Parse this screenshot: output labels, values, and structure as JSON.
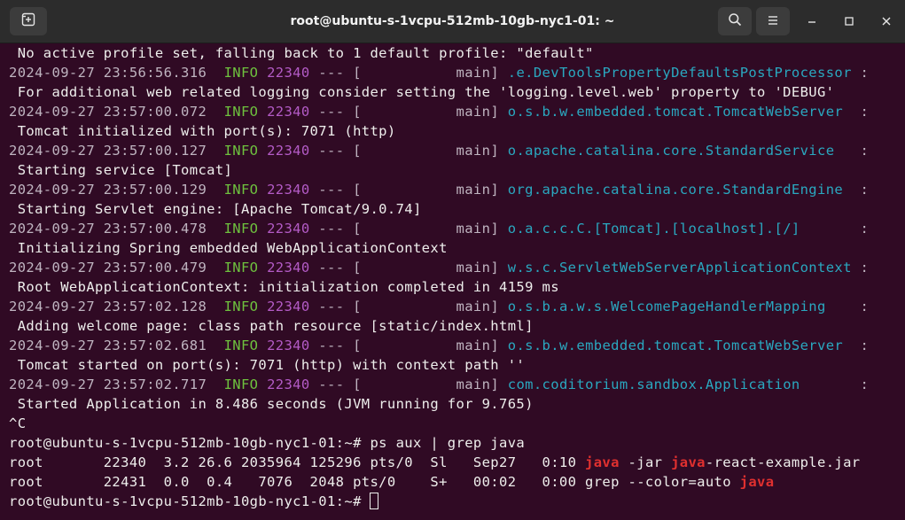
{
  "window": {
    "title": "root@ubuntu-s-1vcpu-512mb-10gb-nyc1-01: ~"
  },
  "icons": {
    "new_tab": "new-tab-icon",
    "search": "search-icon",
    "menu": "hamburger-menu-icon",
    "minimize": "minimize-icon",
    "maximize": "maximize-icon",
    "close": "close-icon"
  },
  "colors": {
    "terminal_bg": "#300a24",
    "titlebar_bg": "#2c2c2c",
    "info": "#6ec13e",
    "pid": "#b35bc6",
    "logger": "#2aa8c0",
    "highlight": "#e0302f"
  },
  "terminal": {
    "lines": [
      {
        "type": "plain",
        "text": " No active profile set, falling back to 1 default profile: \"default\""
      },
      {
        "type": "log",
        "ts": "2024-09-27 23:56:56.316",
        "level": "INFO",
        "pid": "22340",
        "dash": "--- [",
        "thread": "           main]",
        "logger": ".e.DevToolsPropertyDefaultsPostProcessor",
        "sep": ":"
      },
      {
        "type": "plain",
        "text": " For additional web related logging consider setting the 'logging.level.web' property to 'DEBUG'"
      },
      {
        "type": "log",
        "ts": "2024-09-27 23:57:00.072",
        "level": "INFO",
        "pid": "22340",
        "dash": "--- [",
        "thread": "           main]",
        "logger": "o.s.b.w.embedded.tomcat.TomcatWebServer ",
        "sep": ":"
      },
      {
        "type": "plain",
        "text": " Tomcat initialized with port(s): 7071 (http)"
      },
      {
        "type": "log",
        "ts": "2024-09-27 23:57:00.127",
        "level": "INFO",
        "pid": "22340",
        "dash": "--- [",
        "thread": "           main]",
        "logger": "o.apache.catalina.core.StandardService  ",
        "sep": ":"
      },
      {
        "type": "plain",
        "text": " Starting service [Tomcat]"
      },
      {
        "type": "log",
        "ts": "2024-09-27 23:57:00.129",
        "level": "INFO",
        "pid": "22340",
        "dash": "--- [",
        "thread": "           main]",
        "logger": "org.apache.catalina.core.StandardEngine ",
        "sep": ":"
      },
      {
        "type": "plain",
        "text": " Starting Servlet engine: [Apache Tomcat/9.0.74]"
      },
      {
        "type": "log",
        "ts": "2024-09-27 23:57:00.478",
        "level": "INFO",
        "pid": "22340",
        "dash": "--- [",
        "thread": "           main]",
        "logger": "o.a.c.c.C.[Tomcat].[localhost].[/]      ",
        "sep": ":"
      },
      {
        "type": "plain",
        "text": " Initializing Spring embedded WebApplicationContext"
      },
      {
        "type": "log",
        "ts": "2024-09-27 23:57:00.479",
        "level": "INFO",
        "pid": "22340",
        "dash": "--- [",
        "thread": "           main]",
        "logger": "w.s.c.ServletWebServerApplicationContext",
        "sep": ":"
      },
      {
        "type": "plain",
        "text": " Root WebApplicationContext: initialization completed in 4159 ms"
      },
      {
        "type": "log",
        "ts": "2024-09-27 23:57:02.128",
        "level": "INFO",
        "pid": "22340",
        "dash": "--- [",
        "thread": "           main]",
        "logger": "o.s.b.a.w.s.WelcomePageHandlerMapping   ",
        "sep": ":"
      },
      {
        "type": "plain",
        "text": " Adding welcome page: class path resource [static/index.html]"
      },
      {
        "type": "log",
        "ts": "2024-09-27 23:57:02.681",
        "level": "INFO",
        "pid": "22340",
        "dash": "--- [",
        "thread": "           main]",
        "logger": "o.s.b.w.embedded.tomcat.TomcatWebServer ",
        "sep": ":"
      },
      {
        "type": "plain",
        "text": " Tomcat started on port(s): 7071 (http) with context path ''"
      },
      {
        "type": "log",
        "ts": "2024-09-27 23:57:02.717",
        "level": "INFO",
        "pid": "22340",
        "dash": "--- [",
        "thread": "           main]",
        "logger": "com.coditorium.sandbox.Application      ",
        "sep": ":"
      },
      {
        "type": "plain",
        "text": " Started Application in 8.486 seconds (JVM running for 9.765)"
      },
      {
        "type": "plain",
        "text": "^C"
      },
      {
        "type": "plain",
        "text": "root@ubuntu-s-1vcpu-512mb-10gb-nyc1-01:~# ps aux | grep java"
      },
      {
        "type": "segments",
        "segments": [
          {
            "text": "root       22340  3.2 26.6 2035964 125296 pts/0  Sl   Sep27   0:10 ",
            "hl": false
          },
          {
            "text": "java",
            "hl": true
          },
          {
            "text": " -jar ",
            "hl": false
          },
          {
            "text": "java",
            "hl": true
          },
          {
            "text": "-react-example.jar",
            "hl": false
          }
        ]
      },
      {
        "type": "segments",
        "segments": [
          {
            "text": "root       22431  0.0  0.4   7076  2048 pts/0    S+   00:02   0:00 grep --color=auto ",
            "hl": false
          },
          {
            "text": "java",
            "hl": true
          }
        ]
      },
      {
        "type": "prompt",
        "text": "root@ubuntu-s-1vcpu-512mb-10gb-nyc1-01:~# "
      }
    ]
  }
}
